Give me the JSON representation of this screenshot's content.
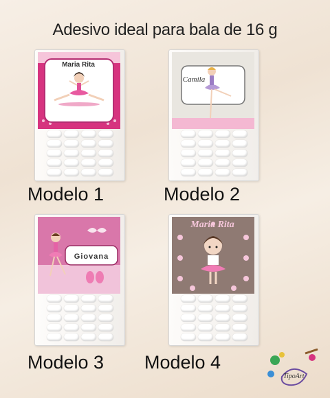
{
  "headline": "Adesivo ideal para bala de 16 g",
  "products": [
    {
      "label_name": "Maria Rita",
      "model_label": "Modelo 1"
    },
    {
      "label_name": "Camila",
      "model_label": "Modelo 2"
    },
    {
      "label_name": "Giovana",
      "model_label": "Modelo 3"
    },
    {
      "label_name": "Maria Rita",
      "model_label": "Modelo 4"
    }
  ],
  "brand": "TipoArt",
  "colors": {
    "pink_dark": "#d6337f",
    "pink_light": "#f4b8d2",
    "lilac": "#b59ad6",
    "taupe": "#8f7a73"
  }
}
